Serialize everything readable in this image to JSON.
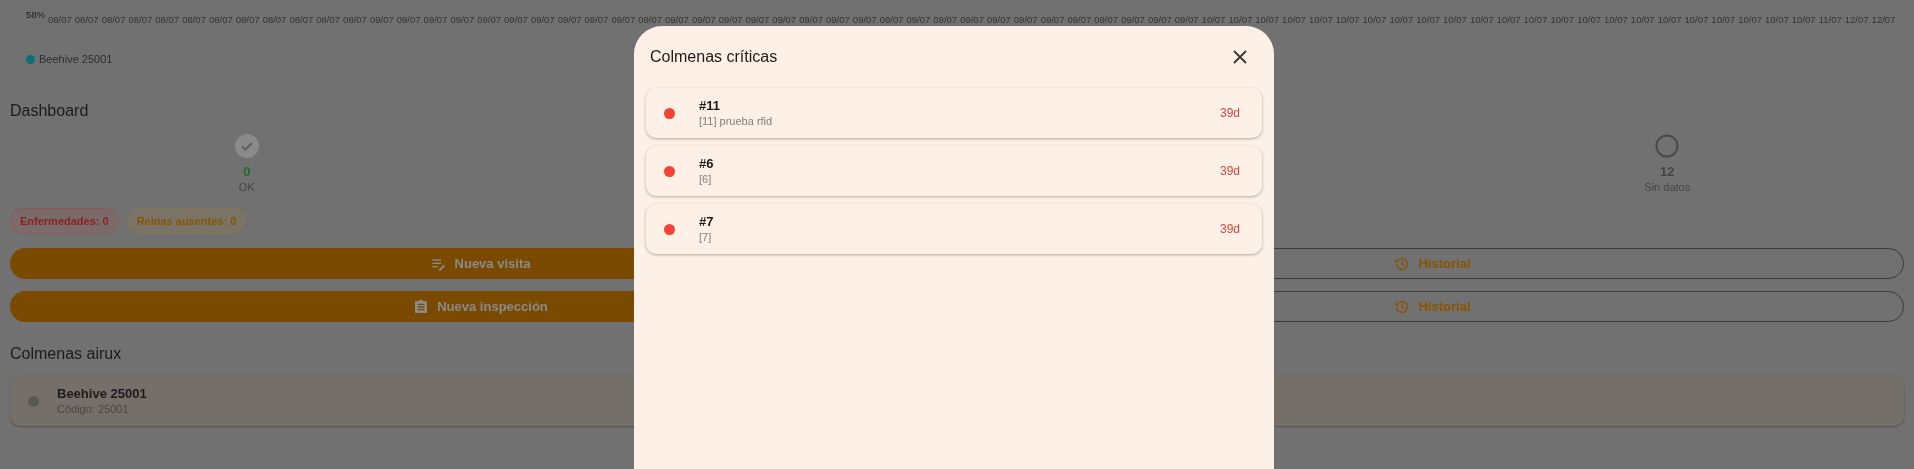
{
  "chart": {
    "y_tick": "58%",
    "x_labels": [
      "08/07",
      "08/07",
      "08/07",
      "08/07",
      "08/07",
      "08/07",
      "08/07",
      "08/07",
      "08/07",
      "08/07",
      "08/07",
      "08/07",
      "09/07",
      "09/07",
      "09/07",
      "09/07",
      "09/07",
      "09/07",
      "09/07",
      "09/07",
      "09/07",
      "09/07",
      "09/07",
      "09/07",
      "09/07",
      "09/07",
      "09/07",
      "09/07",
      "09/07",
      "09/07",
      "09/07",
      "09/07",
      "09/07",
      "09/07",
      "09/07",
      "09/07",
      "09/07",
      "09/07",
      "09/07",
      "09/07",
      "09/07",
      "09/07",
      "09/07",
      "10/07",
      "10/07",
      "10/07",
      "10/07",
      "10/07",
      "10/07",
      "10/07",
      "10/07",
      "10/07",
      "10/07",
      "10/07",
      "10/07",
      "10/07",
      "10/07",
      "10/07",
      "10/07",
      "10/07",
      "10/07",
      "10/07",
      "10/07",
      "10/07",
      "10/07",
      "10/07",
      "11/07",
      "12/07",
      "12/07"
    ],
    "legend": [
      {
        "label": "Beehive 25001",
        "color": "#0b6e78"
      }
    ]
  },
  "dashboard": {
    "title": "Dashboard",
    "stats": [
      {
        "kind": "ok",
        "value": "0",
        "label": "OK"
      },
      {
        "kind": "none",
        "value": "12",
        "label": "Sin datos"
      }
    ],
    "chips": [
      {
        "kind": "danger",
        "label": "Enfermedades: 0"
      },
      {
        "kind": "warning",
        "label": "Reinas ausentes: 0"
      }
    ],
    "action_rows": [
      {
        "primary": {
          "kind": "visit",
          "label": "Nueva visita"
        },
        "secondary": {
          "label": "Historial"
        }
      },
      {
        "primary": {
          "kind": "inspection",
          "label": "Nueva inspección"
        },
        "secondary": {
          "label": "Historial"
        }
      }
    ]
  },
  "hives_section": {
    "title": "Colmenas airux",
    "items": [
      {
        "name": "Beehive 25001",
        "code": "Código: 25001"
      }
    ]
  },
  "dialog": {
    "title": "Colmenas críticas",
    "items": [
      {
        "title": "#11",
        "subtitle": "[11] prueba rfid",
        "age": "39d",
        "color": "#f44336"
      },
      {
        "title": "#6",
        "subtitle": "[6]",
        "age": "39d",
        "color": "#f44336"
      },
      {
        "title": "#7",
        "subtitle": "[7]",
        "age": "39d",
        "color": "#f44336"
      }
    ]
  }
}
